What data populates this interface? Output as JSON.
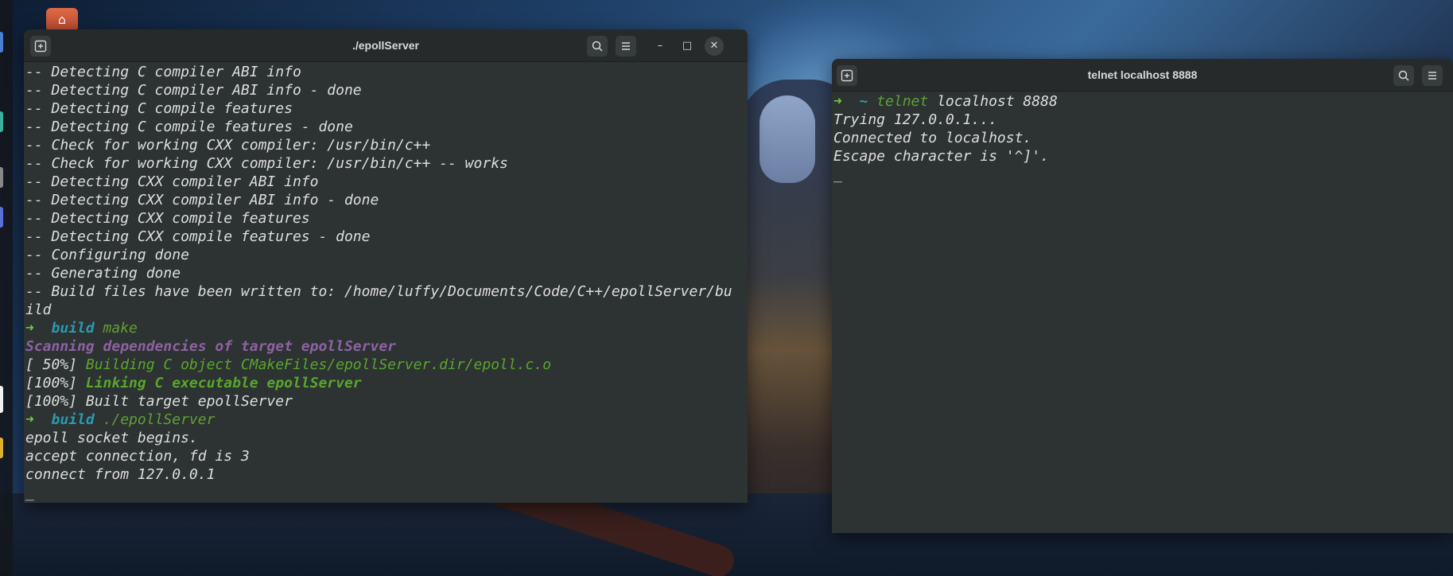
{
  "desktop": {
    "home_icon": "home-icon"
  },
  "window_left": {
    "title": "./epollServer",
    "new_tab_icon": "new-tab-icon",
    "search_icon": "search-icon",
    "menu_icon": "hamburger-menu-icon",
    "minimize": "–",
    "maximize": "□",
    "close": "✕",
    "lines": [
      {
        "segments": [
          {
            "t": "-- Detecting C compiler ABI info",
            "c": "dim"
          }
        ]
      },
      {
        "segments": [
          {
            "t": "-- Detecting C compiler ABI info - done",
            "c": "dim"
          }
        ]
      },
      {
        "segments": [
          {
            "t": "-- Detecting C compile features",
            "c": "dim"
          }
        ]
      },
      {
        "segments": [
          {
            "t": "-- Detecting C compile features - done",
            "c": "dim"
          }
        ]
      },
      {
        "segments": [
          {
            "t": "-- Check for working CXX compiler: /usr/bin/c++",
            "c": "dim"
          }
        ]
      },
      {
        "segments": [
          {
            "t": "-- Check for working CXX compiler: /usr/bin/c++ -- works",
            "c": "dim"
          }
        ]
      },
      {
        "segments": [
          {
            "t": "-- Detecting CXX compiler ABI info",
            "c": "dim"
          }
        ]
      },
      {
        "segments": [
          {
            "t": "-- Detecting CXX compiler ABI info - done",
            "c": "dim"
          }
        ]
      },
      {
        "segments": [
          {
            "t": "-- Detecting CXX compile features",
            "c": "dim"
          }
        ]
      },
      {
        "segments": [
          {
            "t": "-- Detecting CXX compile features - done",
            "c": "dim"
          }
        ]
      },
      {
        "segments": [
          {
            "t": "-- Configuring done",
            "c": "dim"
          }
        ]
      },
      {
        "segments": [
          {
            "t": "-- Generating done",
            "c": "dim"
          }
        ]
      },
      {
        "segments": [
          {
            "t": "-- Build files have been written to: /home/luffy/Documents/Code/C++/epollServer/bu",
            "c": "dim"
          }
        ]
      },
      {
        "segments": [
          {
            "t": "ild",
            "c": "dim"
          }
        ]
      },
      {
        "segments": [
          {
            "t": "➜  ",
            "c": "arrow"
          },
          {
            "t": "build ",
            "c": "dir"
          },
          {
            "t": "make",
            "c": "cmd"
          }
        ]
      },
      {
        "segments": [
          {
            "t": "Scanning dependencies of target epollServer",
            "c": "purple"
          }
        ]
      },
      {
        "segments": [
          {
            "t": "[ 50%] ",
            "c": "dim"
          },
          {
            "t": "Building C object CMakeFiles/epollServer.dir/epoll.c.o",
            "c": "green"
          }
        ]
      },
      {
        "segments": [
          {
            "t": "[100%] ",
            "c": "dim"
          },
          {
            "t": "Linking C executable epollServer",
            "c": "greenb"
          }
        ]
      },
      {
        "segments": [
          {
            "t": "[100%] Built target epollServer",
            "c": "dim"
          }
        ]
      },
      {
        "segments": [
          {
            "t": "➜  ",
            "c": "arrow"
          },
          {
            "t": "build ",
            "c": "dir"
          },
          {
            "t": "./epollServer",
            "c": "cmd"
          }
        ]
      },
      {
        "segments": [
          {
            "t": "epoll socket begins.",
            "c": "dim"
          }
        ]
      },
      {
        "segments": [
          {
            "t": "accept connection, fd is 3",
            "c": "dim"
          }
        ]
      },
      {
        "segments": [
          {
            "t": "connect from 127.0.0.1",
            "c": "dim"
          }
        ]
      },
      {
        "segments": [
          {
            "t": "_",
            "c": "dim"
          }
        ]
      }
    ]
  },
  "window_right": {
    "title": "telnet localhost 8888",
    "new_tab_icon": "new-tab-icon",
    "search_icon": "search-icon",
    "menu_icon": "hamburger-menu-icon",
    "lines": [
      {
        "segments": [
          {
            "t": "➜  ",
            "c": "arrow"
          },
          {
            "t": "~ ",
            "c": "dir"
          },
          {
            "t": "telnet ",
            "c": "cmd"
          },
          {
            "t": "localhost 8888",
            "c": "dim"
          }
        ]
      },
      {
        "segments": [
          {
            "t": "Trying 127.0.0.1...",
            "c": "dim"
          }
        ]
      },
      {
        "segments": [
          {
            "t": "Connected to localhost.",
            "c": "dim"
          }
        ]
      },
      {
        "segments": [
          {
            "t": "Escape character is '^]'.",
            "c": "dim"
          }
        ]
      },
      {
        "segments": [
          {
            "t": "_",
            "c": "dim"
          }
        ]
      }
    ]
  },
  "colors": {
    "terminal_bg": "#2d3233",
    "titlebar_bg": "#262a2b",
    "prompt_arrow": "#6fc93f",
    "prompt_dir": "#2a9bb0",
    "command": "#5fa131",
    "purple": "#8e62a3"
  }
}
